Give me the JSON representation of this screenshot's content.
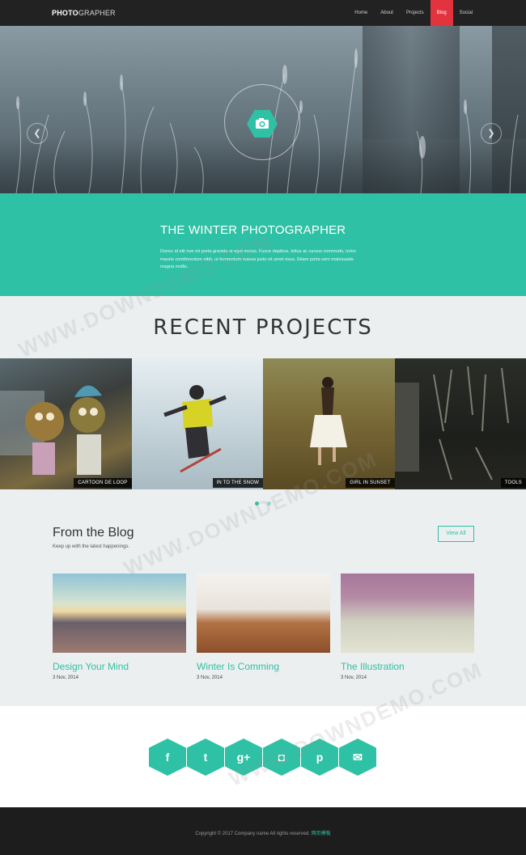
{
  "nav": {
    "logo_bold": "PHOTO",
    "logo_light": "GRAPHER",
    "items": [
      {
        "label": "Home"
      },
      {
        "label": "About"
      },
      {
        "label": "Projects"
      },
      {
        "label": "Blog"
      },
      {
        "label": "Social"
      }
    ],
    "active": "Blog"
  },
  "hero": {
    "prev_icon": "chevron-left-icon",
    "next_icon": "chevron-right-icon",
    "center_icon": "camera-icon"
  },
  "intro": {
    "title": "THE WINTER PHOTOGRAPHER",
    "text": "Donec id elit non mi porta gravida at eget metus. Fusce dapibus, tellus ac cursus commodo, tortor mauris condimentum nibh, ut fermentum massa justo sit amet risus. Etiam porta sem malesuada magna mollis."
  },
  "projects": {
    "title": "RECENT PROJECTS",
    "tiles": [
      {
        "caption": "CARTOON DE LOOP"
      },
      {
        "caption": "IN TO THE SNOW"
      },
      {
        "caption": "GIRL IN SUNSET"
      },
      {
        "caption": "TOOLS"
      }
    ]
  },
  "blog": {
    "title": "From the Blog",
    "subtitle": "Keep up with the latest happenings.",
    "view_all": "View All",
    "posts": [
      {
        "title": "Design Your Mind",
        "date": "3 Nov, 2014"
      },
      {
        "title": "Winter Is Comming",
        "date": "3 Nov, 2014"
      },
      {
        "title": "The Illustration",
        "date": "3 Nov, 2014"
      }
    ]
  },
  "social": {
    "icons": [
      {
        "name": "facebook-icon",
        "glyph": "f"
      },
      {
        "name": "twitter-icon",
        "glyph": "t"
      },
      {
        "name": "google-plus-icon",
        "glyph": "g+"
      },
      {
        "name": "instagram-icon",
        "glyph": "◘"
      },
      {
        "name": "pinterest-icon",
        "glyph": "p"
      },
      {
        "name": "email-icon",
        "glyph": "✉"
      }
    ]
  },
  "footer": {
    "copyright": "Copyright © 2017 Company name All rights reserved.",
    "link": "网页模板"
  },
  "watermark": {
    "text": "WWW.DOWNDEMO.COM"
  },
  "colors": {
    "accent": "#2fc1a5",
    "active_nav": "#e2333f",
    "nav_bg": "#222222",
    "footer_bg": "#1d1d1d"
  }
}
